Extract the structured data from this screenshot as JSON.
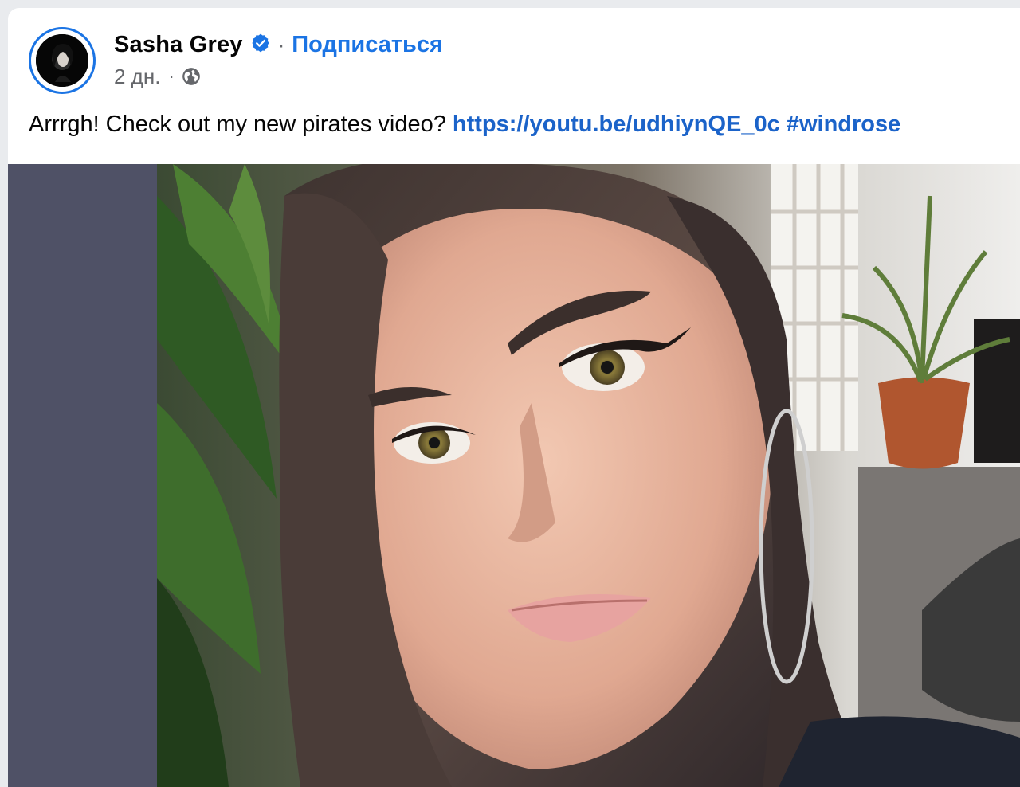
{
  "post": {
    "author": {
      "name": "Sasha Grey",
      "verified": true,
      "avatar_icon": "avatar-photo"
    },
    "follow_label": "Подписаться",
    "separator": "·",
    "time": "2 дн.",
    "audience_icon": "globe-icon",
    "text": "Arrrgh! Check out my new pirates video?",
    "link": "https://youtu.be/udhiynQE_0c",
    "hashtag": "#windrose",
    "media": {
      "type": "photo",
      "left_panel_color": "#4f5166"
    }
  },
  "colors": {
    "link": "#1b74e4",
    "verified": "#1b74e4",
    "secondary_text": "#65676b",
    "primary_text": "#050505"
  }
}
